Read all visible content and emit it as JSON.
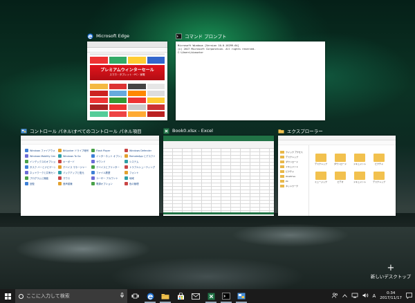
{
  "windows": {
    "edge": {
      "title": "Microsoft Edge",
      "banner_text": "プレミアムウィンターセール",
      "banner_sub": "スマホ・タブレット・PC・家電"
    },
    "cmd": {
      "title": "コマンド プロンプト",
      "lines": [
        "Microsoft Windows [Version 10.0.16299.64]",
        "(c) 2017 Microsoft Corporation. All rights reserved.",
        "",
        "C:\\Users\\kiasato>"
      ]
    },
    "control_panel": {
      "title": "コントロール パネル\\すべてのコントロール パネル項目",
      "items": [
        "Windows ファイアウォール",
        "BitLocker ドライブ暗号化",
        "Flash Player",
        "Windows Defender",
        "Windows Mobility Center",
        "Windows To Go",
        "インターネット オプション",
        "RemoteApp とデスクトップ接続",
        "インデックスのオプション",
        "キーボード",
        "サウンド",
        "システム",
        "タスク バーとナビゲーション",
        "デバイス マネージャー",
        "デバイスとプリンター",
        "トラブルシューティング",
        "ネットワークと共有センター",
        "バックアップと復元",
        "ファイル履歴",
        "フォント",
        "プログラムと機能",
        "マウス",
        "ユーザー アカウント",
        "地域",
        "回復",
        "音声認識",
        "電源オプション",
        "色の管理"
      ]
    },
    "excel": {
      "title": "Book0.xlsx - Excel"
    },
    "explorer": {
      "title": "エクスプローラー",
      "nav": [
        "クイック アクセス",
        "デスクトップ",
        "ダウンロード",
        "ドキュメント",
        "ピクチャ",
        "OneDrive",
        "PC",
        "ネットワーク"
      ],
      "folders": [
        "デスクトップ",
        "ダウンロード",
        "ドキュメント",
        "ピクチャ",
        "ミュージック",
        "ビデオ",
        "ドキュメント",
        "デスクトップ"
      ]
    }
  },
  "new_desktop_label": "新しいデスクトップ",
  "taskbar": {
    "search_placeholder": "ここに入力して検索",
    "apps": [
      "edge-icon",
      "explorer-icon",
      "store-icon",
      "mail-icon",
      "excel-icon",
      "cmd-icon",
      "control-panel-icon"
    ],
    "time": "0:34",
    "date": "2017/11/17",
    "ime": "A"
  },
  "colors": {
    "excel_green": "#217346",
    "edge_blue": "#1e6fd0",
    "taskbar": "#1b1b1b"
  }
}
